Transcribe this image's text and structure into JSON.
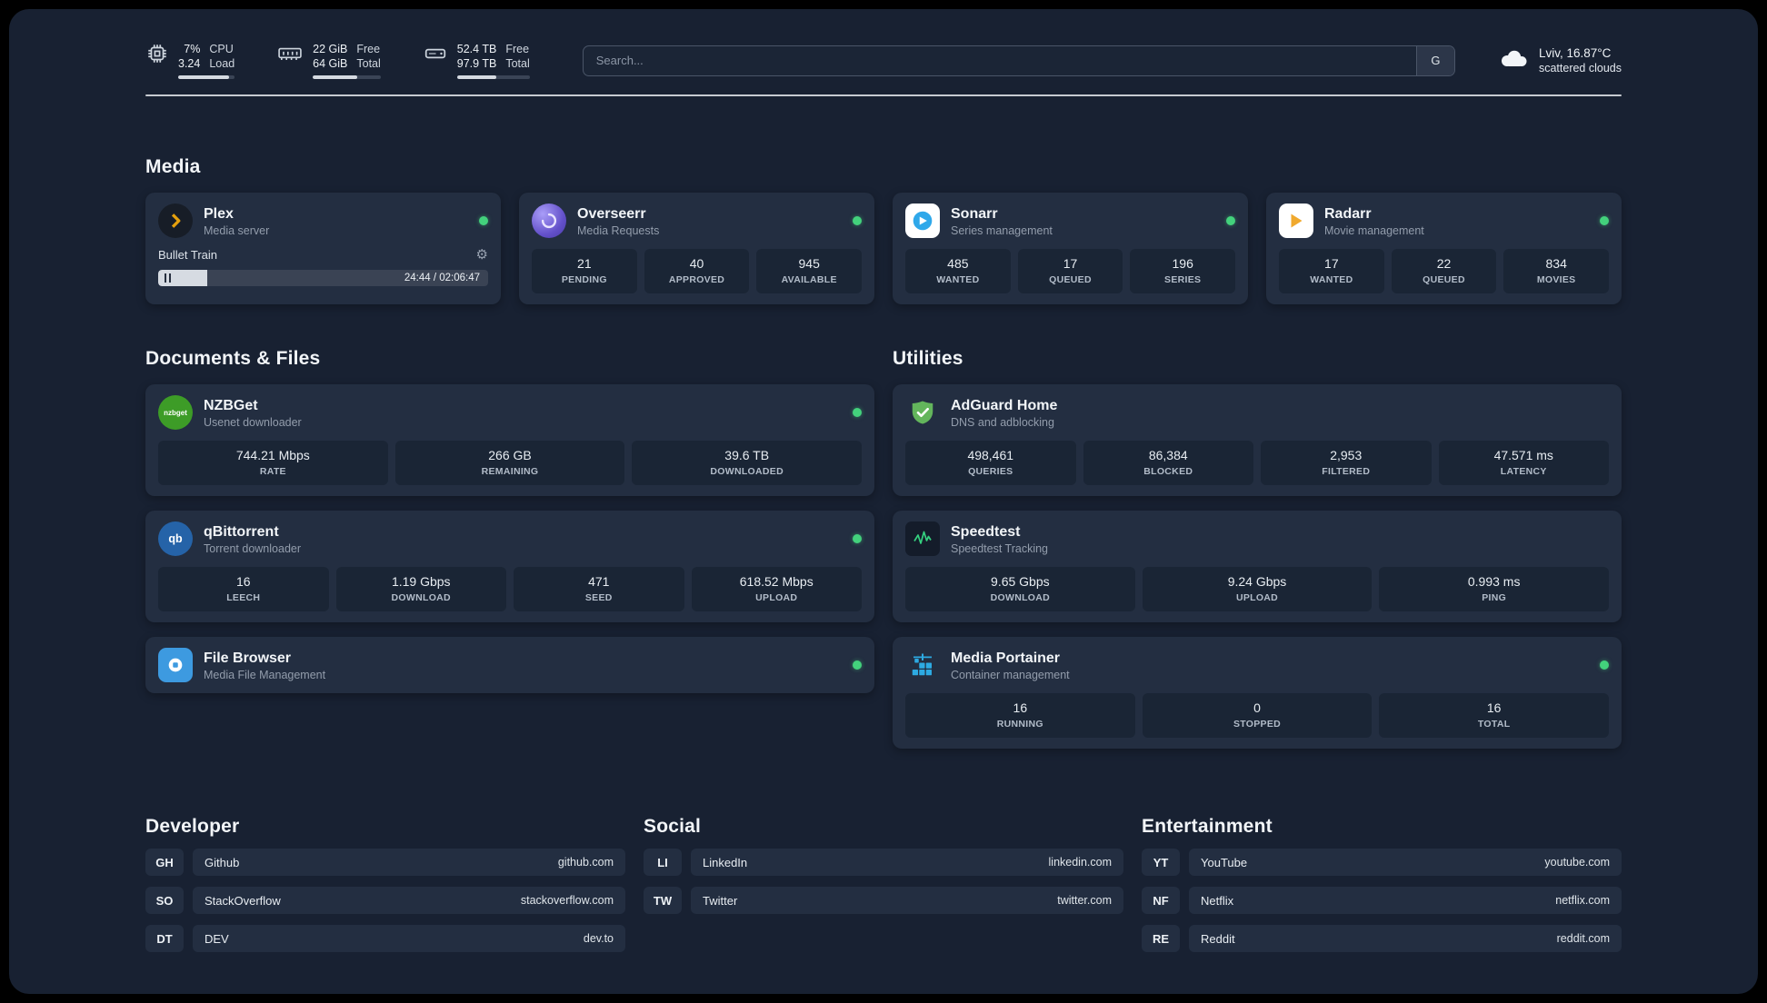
{
  "topbar": {
    "cpu": {
      "value1": "7%",
      "value2": "3.24",
      "label1": "CPU",
      "label2": "Load",
      "progress": "90%"
    },
    "memory": {
      "value1": "22 GiB",
      "value2": "64 GiB",
      "label1": "Free",
      "label2": "Total",
      "progress": "66%"
    },
    "disk": {
      "value1": "52.4 TB",
      "value2": "97.9 TB",
      "label1": "Free",
      "label2": "Total",
      "progress": "54%"
    },
    "search": {
      "placeholder": "Search...",
      "button": "G"
    },
    "weather": {
      "location": "Lviv, 16.87°C",
      "condition": "scattered clouds"
    }
  },
  "media": {
    "title": "Media",
    "plex": {
      "name": "Plex",
      "subtitle": "Media server",
      "now_playing": "Bullet Train",
      "time": "24:44 / 02:06:47",
      "progress": "15%"
    },
    "overseerr": {
      "name": "Overseerr",
      "subtitle": "Media Requests",
      "stats": [
        {
          "v": "21",
          "l": "PENDING"
        },
        {
          "v": "40",
          "l": "APPROVED"
        },
        {
          "v": "945",
          "l": "AVAILABLE"
        }
      ]
    },
    "sonarr": {
      "name": "Sonarr",
      "subtitle": "Series management",
      "stats": [
        {
          "v": "485",
          "l": "WANTED"
        },
        {
          "v": "17",
          "l": "QUEUED"
        },
        {
          "v": "196",
          "l": "SERIES"
        }
      ]
    },
    "radarr": {
      "name": "Radarr",
      "subtitle": "Movie management",
      "stats": [
        {
          "v": "17",
          "l": "WANTED"
        },
        {
          "v": "22",
          "l": "QUEUED"
        },
        {
          "v": "834",
          "l": "MOVIES"
        }
      ]
    }
  },
  "documents": {
    "title": "Documents & Files",
    "nzbget": {
      "name": "NZBGet",
      "subtitle": "Usenet downloader",
      "icon_label": "nzbget",
      "stats": [
        {
          "v": "744.21 Mbps",
          "l": "RATE"
        },
        {
          "v": "266 GB",
          "l": "REMAINING"
        },
        {
          "v": "39.6 TB",
          "l": "DOWNLOADED"
        }
      ]
    },
    "qbittorrent": {
      "name": "qBittorrent",
      "subtitle": "Torrent downloader",
      "icon_label": "qb",
      "stats": [
        {
          "v": "16",
          "l": "LEECH"
        },
        {
          "v": "1.19 Gbps",
          "l": "DOWNLOAD"
        },
        {
          "v": "471",
          "l": "SEED"
        },
        {
          "v": "618.52 Mbps",
          "l": "UPLOAD"
        }
      ]
    },
    "filebrowser": {
      "name": "File Browser",
      "subtitle": "Media File Management"
    }
  },
  "utilities": {
    "title": "Utilities",
    "adguard": {
      "name": "AdGuard Home",
      "subtitle": "DNS and adblocking",
      "stats": [
        {
          "v": "498,461",
          "l": "QUERIES"
        },
        {
          "v": "86,384",
          "l": "BLOCKED"
        },
        {
          "v": "2,953",
          "l": "FILTERED"
        },
        {
          "v": "47.571 ms",
          "l": "LATENCY"
        }
      ]
    },
    "speedtest": {
      "name": "Speedtest",
      "subtitle": "Speedtest Tracking",
      "stats": [
        {
          "v": "9.65 Gbps",
          "l": "DOWNLOAD"
        },
        {
          "v": "9.24 Gbps",
          "l": "UPLOAD"
        },
        {
          "v": "0.993 ms",
          "l": "PING"
        }
      ]
    },
    "portainer": {
      "name": "Media Portainer",
      "subtitle": "Container management",
      "stats": [
        {
          "v": "16",
          "l": "RUNNING"
        },
        {
          "v": "0",
          "l": "STOPPED"
        },
        {
          "v": "16",
          "l": "TOTAL"
        }
      ]
    }
  },
  "bookmarks": {
    "developer": {
      "title": "Developer",
      "items": [
        {
          "abbr": "GH",
          "name": "Github",
          "url": "github.com"
        },
        {
          "abbr": "SO",
          "name": "StackOverflow",
          "url": "stackoverflow.com"
        },
        {
          "abbr": "DT",
          "name": "DEV",
          "url": "dev.to"
        }
      ]
    },
    "social": {
      "title": "Social",
      "items": [
        {
          "abbr": "LI",
          "name": "LinkedIn",
          "url": "linkedin.com"
        },
        {
          "abbr": "TW",
          "name": "Twitter",
          "url": "twitter.com"
        }
      ]
    },
    "entertainment": {
      "title": "Entertainment",
      "items": [
        {
          "abbr": "YT",
          "name": "YouTube",
          "url": "youtube.com"
        },
        {
          "abbr": "NF",
          "name": "Netflix",
          "url": "netflix.com"
        },
        {
          "abbr": "RE",
          "name": "Reddit",
          "url": "reddit.com"
        }
      ]
    }
  }
}
